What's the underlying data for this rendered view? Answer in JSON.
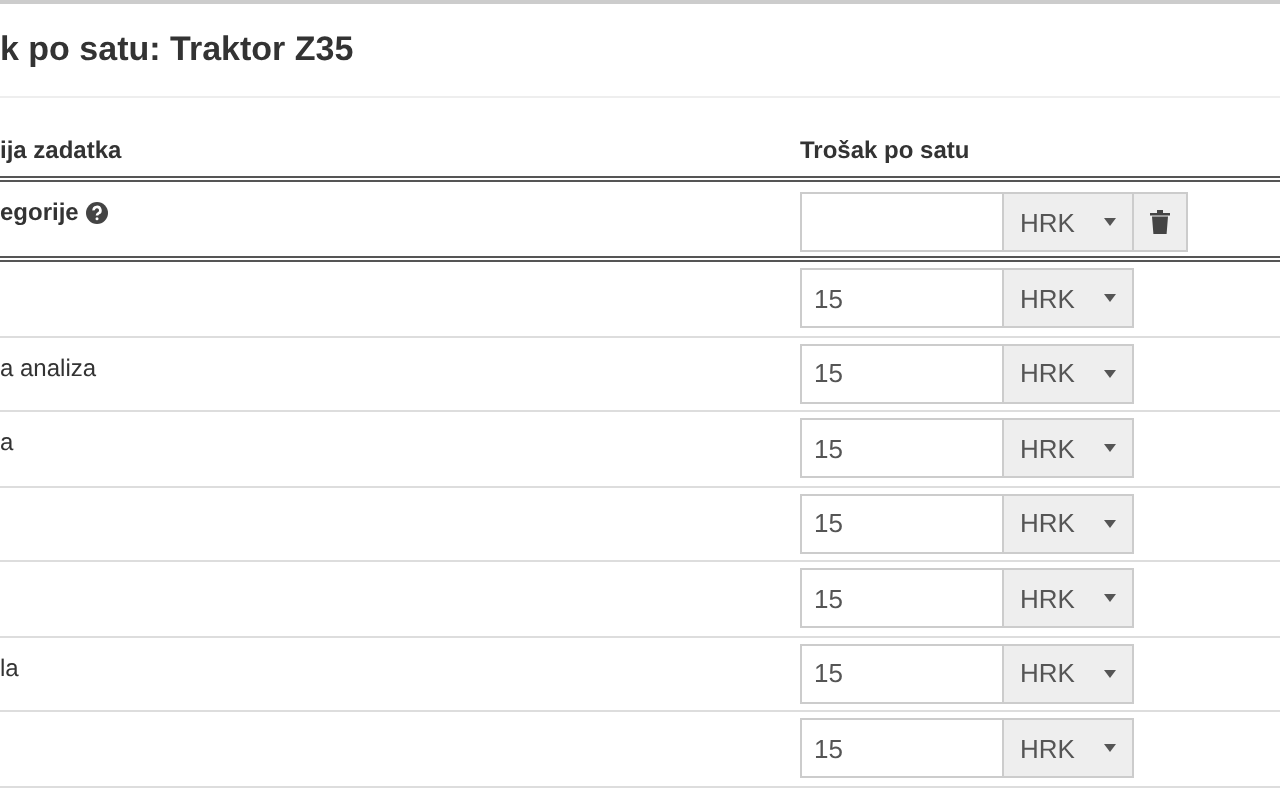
{
  "title": "k po satu: Traktor Z35",
  "table": {
    "columns": [
      "ija zadatka",
      "Trošak po satu"
    ],
    "new_row": {
      "label": "egorije",
      "currency": "HRK"
    },
    "rows": [
      {
        "value": "15",
        "currency": "HRK"
      },
      {
        "label": "a analiza",
        "value": "15",
        "currency": "HRK"
      },
      {
        "label": "a",
        "value": "15",
        "currency": "HRK"
      },
      {
        "value": "15",
        "currency": "HRK"
      },
      {
        "value": "15",
        "currency": "HRK"
      },
      {
        "label": "la",
        "value": "15",
        "currency": "HRK"
      },
      {
        "value": "15",
        "currency": "HRK"
      }
    ]
  }
}
